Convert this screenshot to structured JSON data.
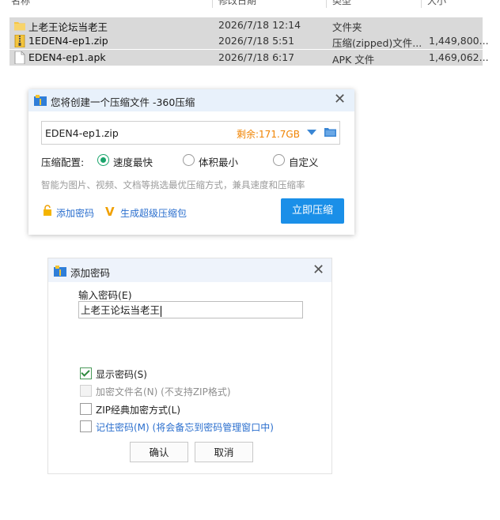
{
  "file_list": {
    "headers": [
      "名称",
      "修改日期",
      "类型",
      "大小"
    ],
    "rows": [
      {
        "name": "上老王论坛当老王",
        "date": "2026/7/18 12:14",
        "type": "文件夹",
        "size": "",
        "icon": "folder-icon"
      },
      {
        "name": "1EDEN4-ep1.zip",
        "date": "2026/7/18 5:51",
        "type": "压缩(zipped)文件...",
        "size": "1,449,800...",
        "icon": "zip-file-icon"
      },
      {
        "name": "EDEN4-ep1.apk",
        "date": "2026/7/18 6:17",
        "type": "APK 文件",
        "size": "1,469,062...",
        "icon": "file-icon"
      }
    ]
  },
  "compress_dialog": {
    "title": "您将创建一个压缩文件 -360压缩",
    "file_name": "EDEN4-ep1.zip",
    "remaining": "剩余:171.7GB",
    "config_label": "压缩配置:",
    "options": [
      "速度最快",
      "体积最小",
      "自定义"
    ],
    "selected_option": "速度最快",
    "hint": "智能为图片、视频、文档等挑选最优压缩方式，兼具速度和压缩率",
    "add_password": "添加密码",
    "super_pack": "生成超级压缩包",
    "compress_now": "立即压缩",
    "accent_color": "#1a8fe8",
    "remaining_color": "#f08300"
  },
  "password_dialog": {
    "title": "添加密码",
    "input_label": "输入密码(E)",
    "password_value": "上老王论坛当老王",
    "show_password": "显示密码(S)",
    "encrypt_filenames": "加密文件名(N) (不支持ZIP格式)",
    "zip_classic": "ZIP经典加密方式(L)",
    "remember_password": "记住密码(M) (将会备忘到密码管理窗口中)",
    "ok": "确认",
    "cancel": "取消",
    "show_password_checked": true,
    "encrypt_filenames_disabled": true,
    "zip_classic_checked": false,
    "remember_checked": false
  }
}
